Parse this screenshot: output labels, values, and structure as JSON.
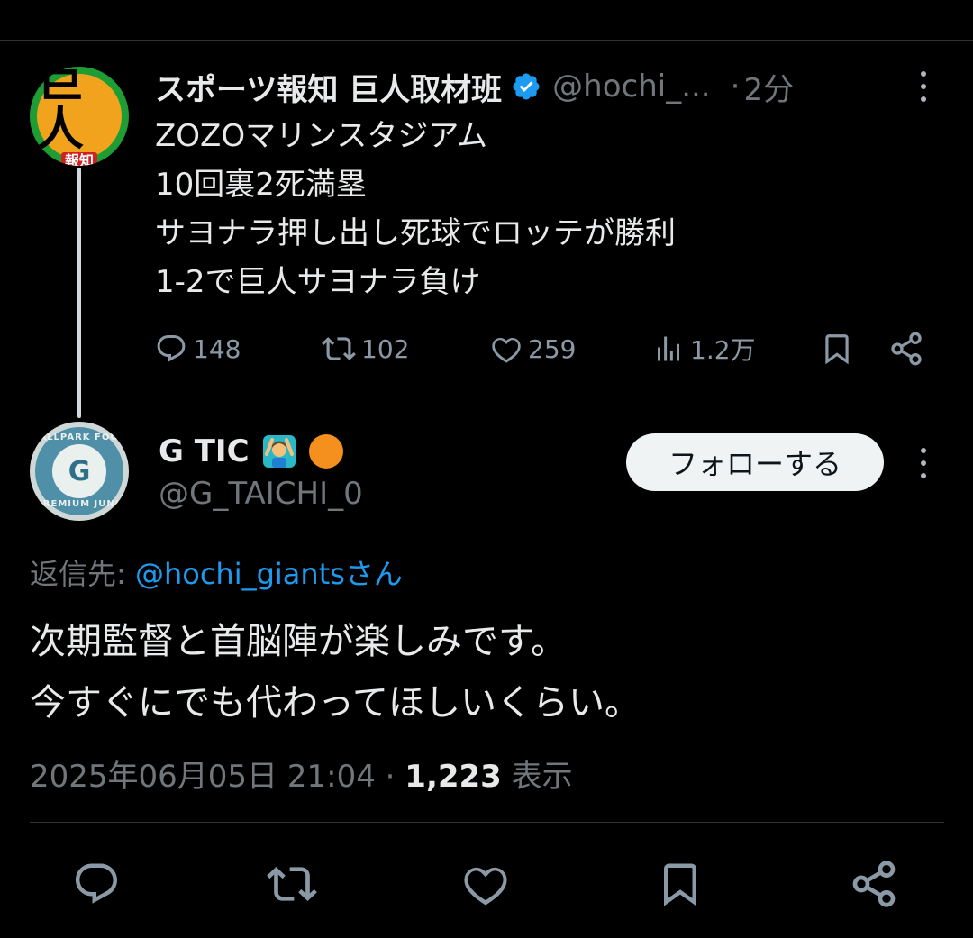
{
  "parent_tweet": {
    "avatar_big": "巨人",
    "avatar_small": "報知",
    "name": "スポーツ報知 巨人取材班",
    "handle": "@hochi_...",
    "separator": "·",
    "time": "2分",
    "text": "ZOZOマリンスタジアム\n10回裏2死満塁\nサヨナラ押し出し死球でロッテが勝利\n1-2で巨人サヨナラ負け",
    "actions": {
      "replies": "148",
      "retweets": "102",
      "likes": "259",
      "views": "1.2万"
    }
  },
  "reply_tweet": {
    "avatar_top": "BALLPARK FOOD",
    "avatar_center": "G",
    "avatar_bottom": "PREMIUM JUNK",
    "name": "G TIC",
    "handle": "@G_TAICHI_0",
    "follow_label": "フォローする",
    "reply_to_prefix": "返信先: ",
    "reply_to_mention": "@hochi_giantsさん",
    "text": "次期監督と首脳陣が楽しみです。\n今すぐにでも代わってほしいくらい。",
    "date": "2025年06月05日 21:04",
    "separator": " · ",
    "views_count": "1,223",
    "views_label": " 表示"
  },
  "colors": {
    "background": "#000000",
    "text": "#e7e9ea",
    "secondary": "#71767b",
    "accent": "#1d9bf0",
    "divider": "#2f3336"
  },
  "icons": [
    "verified-badge-icon",
    "more-options-icon",
    "reply-icon",
    "retweet-icon",
    "like-icon",
    "views-icon",
    "bookmark-icon",
    "share-icon",
    "person-gesturing-ok-emoji",
    "orange-circle-emoji"
  ]
}
